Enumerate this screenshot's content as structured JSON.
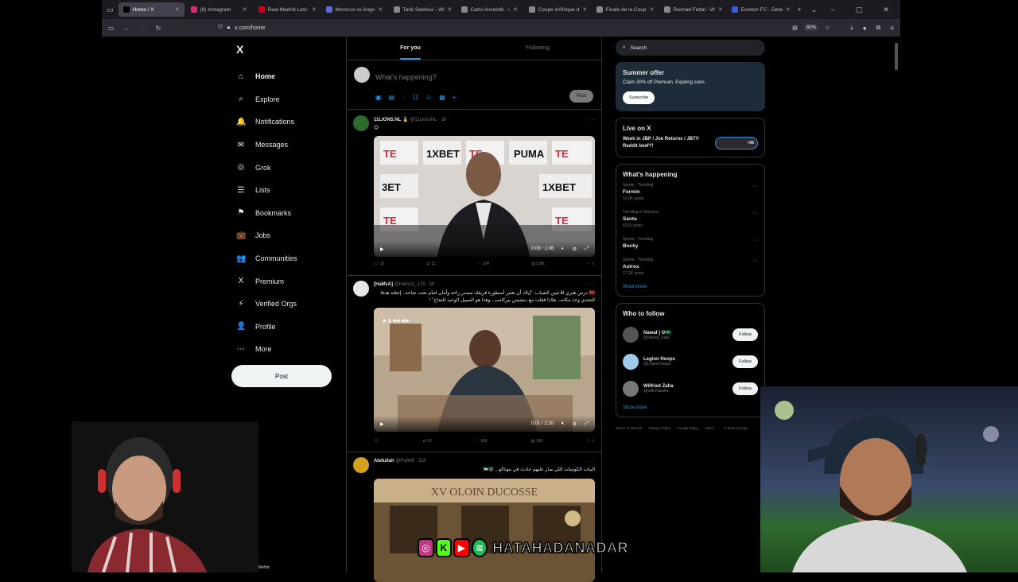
{
  "browser": {
    "tabs": [
      {
        "label": "Home / X",
        "color": "#000000",
        "active": true
      },
      {
        "label": "(6) Instagram",
        "color": "#d62976"
      },
      {
        "label": "Real Madrid Last-",
        "color": "#d0021b"
      },
      {
        "label": "Morocco vs Ango",
        "color": "#5b6bd9"
      },
      {
        "label": "Tarik Sektioui - Wi",
        "color": "#888888"
      },
      {
        "label": "Carlo Ancelotti - \\",
        "color": "#888888"
      },
      {
        "label": "Coupe d'Afrique d",
        "color": "#888888"
      },
      {
        "label": "Finale de la Coup",
        "color": "#888888"
      },
      {
        "label": "Rachad Fettal - W",
        "color": "#888888"
      },
      {
        "label": "Everton FC - Deta",
        "color": "#3a5ad9"
      }
    ],
    "url": "x.com/home",
    "zoom": "80%"
  },
  "nav": {
    "logo": "X",
    "items": [
      {
        "label": "Home",
        "icon": "⌂"
      },
      {
        "label": "Explore",
        "icon": "⌕"
      },
      {
        "label": "Notifications",
        "icon": "🔔"
      },
      {
        "label": "Messages",
        "icon": "✉"
      },
      {
        "label": "Grok",
        "icon": "◎"
      },
      {
        "label": "Lists",
        "icon": "☰"
      },
      {
        "label": "Bookmarks",
        "icon": "⚑"
      },
      {
        "label": "Jobs",
        "icon": "💼"
      },
      {
        "label": "Communities",
        "icon": "👥"
      },
      {
        "label": "Premium",
        "icon": "X"
      },
      {
        "label": "Verified Orgs",
        "icon": "⚡"
      },
      {
        "label": "Profile",
        "icon": "👤"
      },
      {
        "label": "More",
        "icon": "⋯"
      }
    ],
    "post_label": "Post"
  },
  "timeline": {
    "tabs": [
      "For you",
      "Following"
    ],
    "composer_placeholder": "What's happening?",
    "composer_post": "Post",
    "tweets": [
      {
        "name": "11LIONS.NL",
        "handle": "@11LionsNL · 1h",
        "text": "😊",
        "video_time": "0:09 / 1:06",
        "actions": [
          "10",
          "11",
          "104",
          "5.8K"
        ]
      },
      {
        "name": "[HaMzA]",
        "handle": "@Hamza_213 · 3h",
        "text": "🇲🇦 درس هنري للاعبين الشباب: \"إياك أن تعتبر أسطورة فريقك مصدر راحة وأمان لتنام تحت جناحه.. إجعله هدفا للتحدي وخذ مكانه.. هكذا فعلت مع ديشبس بيركامب.. وهذا هو السبيل الوحيد للنجاح\" ! ",
        "video_time": "0:01 / 2:20",
        "actions": [
          "",
          "15",
          "156",
          "16K"
        ]
      },
      {
        "name": "Abdullah",
        "handle": "@Po848 · 11h",
        "text": "البنات الكويتيات اللي صار عليهم حادث في موناكو .. 😢🇰🇼",
        "sign": "XV OLOIN DUCOSSE"
      }
    ]
  },
  "sidebar": {
    "search_placeholder": "Search",
    "summer": {
      "title": "Summer offer",
      "text": "Claim 30% off Premium. Expiring soon.",
      "button": "Subscribe"
    },
    "live": {
      "title": "Live on X",
      "text": "Week in JBP / Joe Returns / JBTV Reddit beef?!",
      "count": "+96"
    },
    "trending": {
      "title": "What's happening",
      "items": [
        {
          "cat": "Sports · Trending",
          "name": "Fermin",
          "count": "16.6K posts"
        },
        {
          "cat": "Trending in Morocco",
          "name": "Santa",
          "count": "437K posts"
        },
        {
          "cat": "Sports · Trending",
          "name": "Bocky",
          "count": ""
        },
        {
          "cat": "Sports · Trending",
          "name": "Astros",
          "count": "17.2K posts"
        }
      ],
      "show_more": "Show more"
    },
    "who": {
      "title": "Who to follow",
      "items": [
        {
          "name": "Nawaf | ✪🇸🇦",
          "handle": "@Nawaf_Data",
          "color": "#555555"
        },
        {
          "name": "Legion Hoops",
          "handle": "@LegionHoops",
          "color": "#9ecbe8"
        },
        {
          "name": "Wilfried Zaha",
          "handle": "@wilfriedzaha",
          "color": "#777777"
        }
      ],
      "follow": "Follow",
      "show_more": "Show more"
    },
    "footer": [
      "Terms of Service",
      "Privacy Policy",
      "Cookie Policy",
      "More ...",
      "© 2025 X Corp."
    ]
  },
  "stream": {
    "overlay_text": "HATAHADANADAR",
    "left_cam_label": "Mehdi"
  }
}
